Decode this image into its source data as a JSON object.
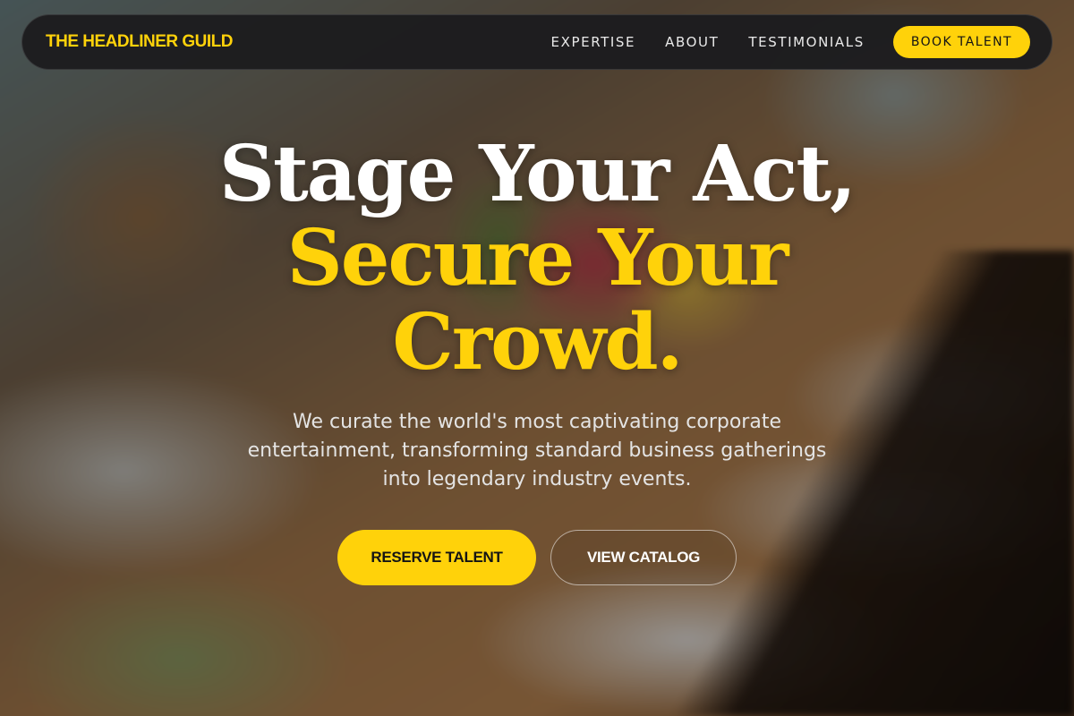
{
  "brand": {
    "name": "THE HEADLINER GUILD"
  },
  "nav": {
    "links": [
      "EXPERTISE",
      "ABOUT",
      "TESTIMONIALS"
    ],
    "cta": "BOOK TALENT"
  },
  "hero": {
    "line1": "Stage Your Act,",
    "line2": "Secure Your",
    "line3": "Crowd.",
    "subtitle": "We curate the world's most captivating corporate entertainment, transforming standard business gatherings into legendary industry events.",
    "primary_button": "RESERVE TALENT",
    "secondary_button": "VIEW CATALOG"
  },
  "colors": {
    "accent": "#ffd20a",
    "nav_background": "#1c1c1e",
    "text_light": "#ffffff"
  }
}
